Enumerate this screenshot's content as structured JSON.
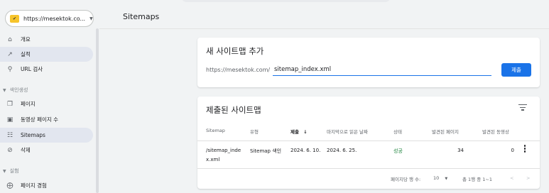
{
  "property": {
    "label": "https://mesektok.co...",
    "caret": "▼"
  },
  "sidebar": {
    "items": [
      {
        "label": "개요",
        "icon": "home-icon"
      },
      {
        "label": "실적",
        "icon": "trending-icon"
      },
      {
        "label": "URL 검사",
        "icon": "search-icon"
      },
      {
        "label": "페이지",
        "icon": "pages-icon"
      },
      {
        "label": "동영상 페이지 수",
        "icon": "video-pages-icon"
      },
      {
        "label": "Sitemaps",
        "icon": "sitemap-icon"
      },
      {
        "label": "삭제",
        "icon": "remove-icon"
      },
      {
        "label": "페이지 경험",
        "icon": "page-experience-icon"
      }
    ],
    "sections": [
      {
        "label": "색인생성"
      },
      {
        "label": "실험"
      }
    ]
  },
  "header": {
    "title": "Sitemaps"
  },
  "add_card": {
    "title": "새 사이트맵 추가",
    "url_prefix": "https://mesektok.com/",
    "input_value": "sitemap_index.xml",
    "submit_label": "제출"
  },
  "list_card": {
    "title": "제출된 사이트맵",
    "columns": [
      "Sitemap",
      "유형",
      "제출",
      "마지막으로 읽은 날짜",
      "상태",
      "발견된 페이지",
      "발견된 동영상"
    ],
    "sort_arrow": "↓",
    "rows": [
      {
        "sitemap_line1": "/sitemap_inde",
        "sitemap_line2": "x.xml",
        "type": "Sitemap 색인",
        "submitted": "2024. 6. 10.",
        "last_read": "2024. 6. 25.",
        "status": "성공",
        "pages": "34",
        "videos": "0"
      }
    ],
    "pager": {
      "rows_per_page_label": "페이지당 행 수:",
      "rows_per_page": "10",
      "range": "총 1행 중 1~1",
      "prev": "<",
      "next": ">"
    }
  },
  "colors": {
    "accent": "#1a73e8",
    "success": "#188038",
    "active_nav": "#e2e6ef"
  }
}
